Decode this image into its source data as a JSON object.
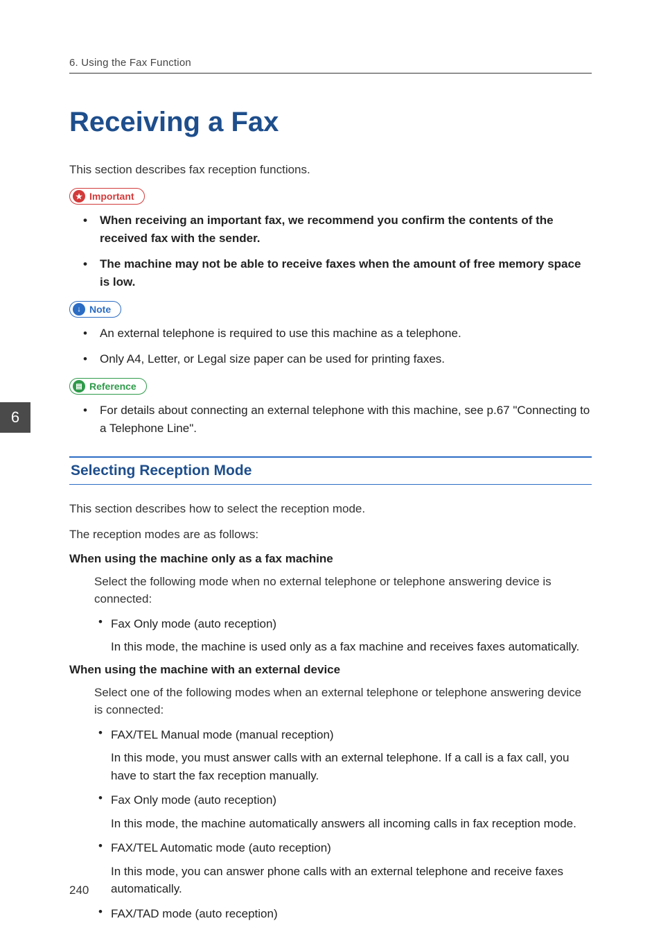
{
  "header": {
    "chapter": "6. Using the Fax Function"
  },
  "title": "Receiving a Fax",
  "intro": "This section describes fax reception functions.",
  "callouts": {
    "important": {
      "label": "Important",
      "items": [
        "When receiving an important fax, we recommend you confirm the contents of the received fax with the sender.",
        "The machine may not be able to receive faxes when the amount of free memory space is low."
      ]
    },
    "note": {
      "label": "Note",
      "items": [
        "An external telephone is required to use this machine as a telephone.",
        "Only A4, Letter, or Legal size paper can be used for printing faxes."
      ]
    },
    "reference": {
      "label": "Reference",
      "items": [
        "For details about connecting an external telephone with this machine, see p.67 \"Connecting to a Telephone Line\"."
      ]
    }
  },
  "section": {
    "heading": "Selecting Reception Mode",
    "p1": "This section describes how to select the reception mode.",
    "p2": "The reception modes are as follows:",
    "defs": [
      {
        "title": "When using the machine only as a fax machine",
        "intro": "Select the following mode when no external telephone or telephone answering device is connected:",
        "modes": [
          {
            "title": "Fax Only mode (auto reception)",
            "desc": "In this mode, the machine is used only as a fax machine and receives faxes automatically."
          }
        ]
      },
      {
        "title": "When using the machine with an external device",
        "intro": "Select one of the following modes when an external telephone or telephone answering device is connected:",
        "modes": [
          {
            "title": "FAX/TEL Manual mode (manual reception)",
            "desc": "In this mode, you must answer calls with an external telephone. If a call is a fax call, you have to start the fax reception manually."
          },
          {
            "title": "Fax Only mode (auto reception)",
            "desc": "In this mode, the machine automatically answers all incoming calls in fax reception mode."
          },
          {
            "title": "FAX/TEL Automatic mode (auto reception)",
            "desc": "In this mode, you can answer phone calls with an external telephone and receive faxes automatically."
          },
          {
            "title": "FAX/TAD mode (auto reception)",
            "desc": ""
          }
        ]
      }
    ]
  },
  "sideTab": "6",
  "pageNumber": "240"
}
